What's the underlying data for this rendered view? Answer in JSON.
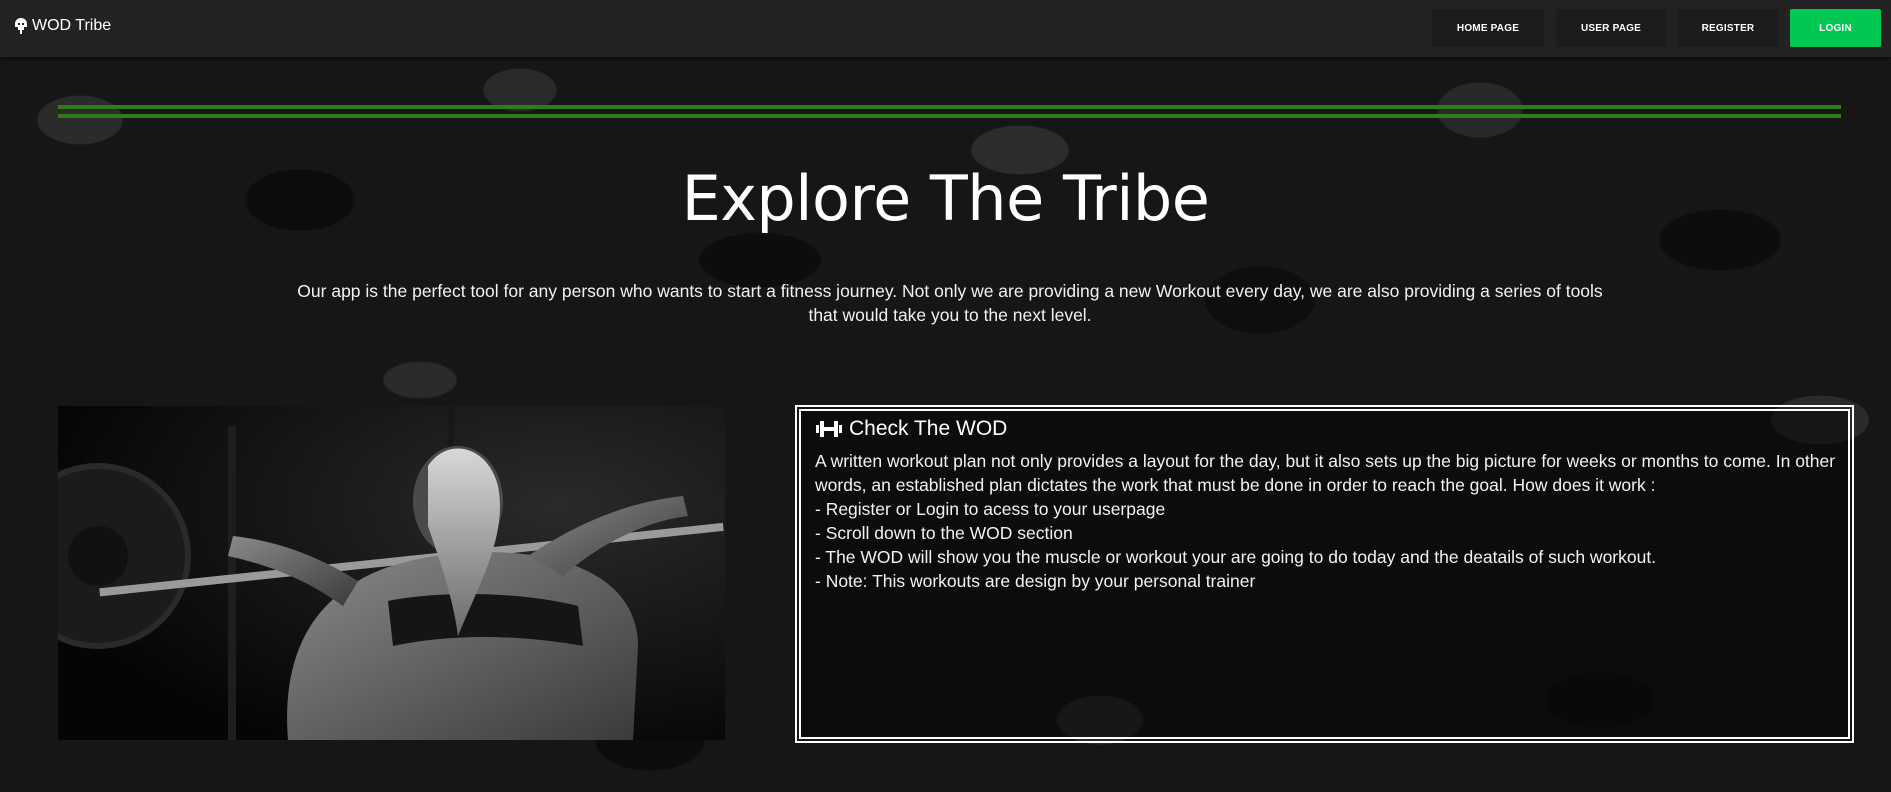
{
  "navbar": {
    "brand": "WOD Tribe",
    "brand_icon": "helmet-icon",
    "links": {
      "home": "HOME PAGE",
      "user": "USER PAGE",
      "register": "REGISTER",
      "login": "LOGIN"
    }
  },
  "colors": {
    "accent_green": "#00c853",
    "rule_green": "#2e7d16",
    "background": "#161616"
  },
  "hero": {
    "title": "Explore The Tribe",
    "intro": "Our app is the perfect tool for any person who wants to start a fitness journey. Not only we are providing a new Workout every day, we are also providing a series of tools that would take you to the next level."
  },
  "photo": {
    "icon": "barbell-athlete-photo"
  },
  "card": {
    "icon": "dumbbell-icon",
    "title": "Check The WOD",
    "description": "A written workout plan not only provides a layout for the day, but it also sets up the big picture for weeks or months to come. In other words, an established plan dictates the work that must be done in order to reach the goal. How does it work :",
    "steps": [
      "- Register or Login to acess to your userpage",
      "- Scroll down to the WOD section",
      "- The WOD will show you the muscle or workout your are going to do today and the deatails of such workout.",
      "- Note: This workouts are design by your personal trainer"
    ]
  }
}
